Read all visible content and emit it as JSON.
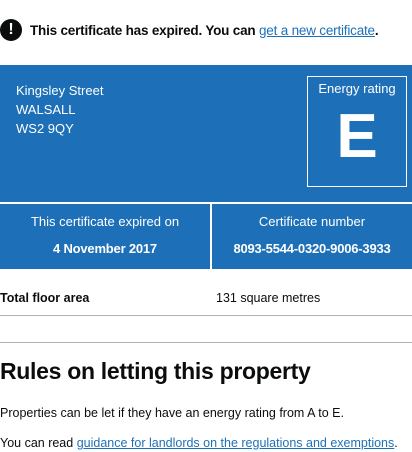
{
  "warning": {
    "icon": "exclamation-icon",
    "icon_glyph": "!",
    "text": "This certificate has expired. You can ",
    "link": "get a new certificate",
    "suffix": "."
  },
  "summary": {
    "background_color": "#1d70b8",
    "address": {
      "line1": "Kingsley Street",
      "line2": "WALSALL",
      "line3": "WS2 9QY"
    },
    "rating": {
      "label": "Energy rating",
      "letter": "E"
    },
    "expiry": {
      "label": "This certificate expired on",
      "value": "4 November 2017"
    },
    "certificate": {
      "label": "Certificate number",
      "value": "8093-5544-0320-9006-3933"
    }
  },
  "floor_area": {
    "label": "Total floor area",
    "value": "131 square metres"
  },
  "rules": {
    "title": "Rules on letting this property",
    "para1": "Properties can be let if they have an energy rating from A to E.",
    "para2_prefix": "You can read ",
    "para2_link": "guidance for landlords on the regulations and exemptions",
    "para2_suffix": "."
  },
  "colors": {
    "link": "#1d70b8",
    "text": "#0b0c0c",
    "divider": "#b1b4b6"
  }
}
